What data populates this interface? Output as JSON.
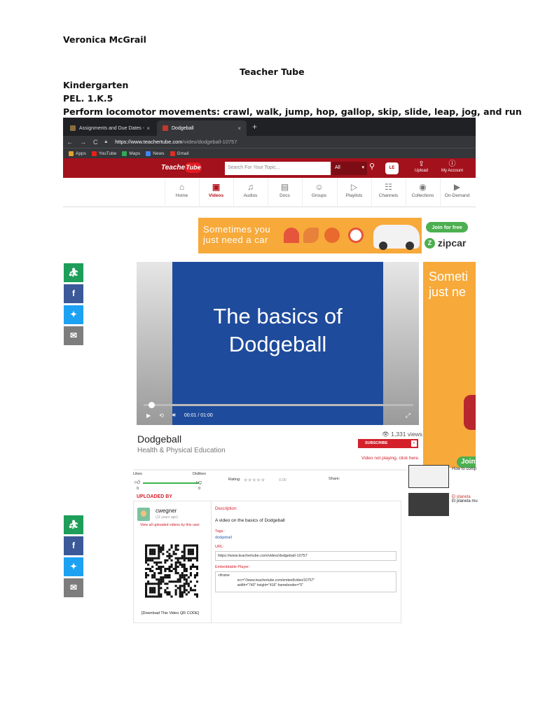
{
  "doc": {
    "author": "Veronica McGrail",
    "title": "Teacher Tube",
    "grade": "Kindergarten",
    "standard": "PEL. 1.K.5",
    "objective": "Perform locomotor movements: crawl, walk, jump, hop, gallop, skip, slide, leap, jog, and run"
  },
  "browser": {
    "tabs": [
      {
        "label": "Assignments and Due Dates -",
        "close": "×"
      },
      {
        "label": "Dodgeball",
        "close": "×"
      }
    ],
    "new_tab": "+",
    "url_host": "https://www.teachertube.com",
    "url_path": "/video/dodgeball-10757",
    "bookmarks": [
      {
        "label": "Apps",
        "color": "#e0a030"
      },
      {
        "label": "YouTube",
        "color": "#e62117"
      },
      {
        "label": "Maps",
        "color": "#34a853"
      },
      {
        "label": "News",
        "color": "#4285f4"
      },
      {
        "label": "Gmail",
        "color": "#d93025"
      }
    ]
  },
  "site": {
    "logo_word": "Teacher",
    "logo_mark": "Tube",
    "search_placeholder": "Search For Your Topic...",
    "search_filter": "All",
    "lt_label": "LE",
    "upload_label": "Upload",
    "account_label": "My Account",
    "menu": [
      {
        "label": "Home",
        "icon": "⌂"
      },
      {
        "label": "Videos",
        "icon": "▣"
      },
      {
        "label": "Audios",
        "icon": "♫"
      },
      {
        "label": "Docs",
        "icon": "▤"
      },
      {
        "label": "Groups",
        "icon": "☺"
      },
      {
        "label": "Playlists",
        "icon": "▷"
      },
      {
        "label": "Channels",
        "icon": "☷"
      },
      {
        "label": "Collections",
        "icon": "◉"
      },
      {
        "label": "On-Demand",
        "icon": "▶"
      }
    ],
    "active_menu": "Videos",
    "accent": "#a3111c"
  },
  "ad": {
    "line1": "Sometimes you",
    "line2": "just need a car",
    "join": "Join for free",
    "brand": "zipcar",
    "brand_mark": "Z",
    "side_line1": "Someti",
    "side_line2": "just ne",
    "side_join": "Join"
  },
  "player": {
    "title_line1": "The basics of",
    "title_line2": "Dodgeball",
    "time": "00:01 / 01:00",
    "progress": 0.017
  },
  "video": {
    "title": "Dodgeball",
    "category": "Health & Physical Education",
    "views": "1,331 views",
    "subscribe": "SUBSCRIBE",
    "not_playing": "Video not playing, click here.",
    "likes_label": "Likes",
    "dislikes_label": "Dislikes",
    "likes": "0",
    "dislikes": "0",
    "rating_label": "Rating:",
    "rating": "0.00",
    "share_label": "Share:"
  },
  "related": [
    {
      "title": "",
      "sub": "How to comp"
    },
    {
      "title": "El planeta",
      "sub": "El planeta mu"
    }
  ],
  "uploader": {
    "section": "UPLOADED BY",
    "name": "cwegner",
    "ago": "(11 years ago)",
    "view_all": "View all uploaded videos by this user",
    "qr_download": "[Download This Video QR CODE]"
  },
  "details": {
    "desc_label": "Description:",
    "desc": "A video on the basics of Dodgeball",
    "tags_label": "Tags :",
    "tag": "dodgeball",
    "url_label": "URL:",
    "url": "https://www.teachertube.com/video/dodgeball-10757",
    "embed_label": "Embeddable Player:",
    "embed": "<iframe\n                    src=\"//www.teachertube.com/embed/video/10757\"\n                    width=\"740\" height=\"416\" frameborder=\"0\""
  },
  "share_icons": [
    "classroom-icon",
    "facebook-icon",
    "twitter-icon",
    "email-icon"
  ]
}
